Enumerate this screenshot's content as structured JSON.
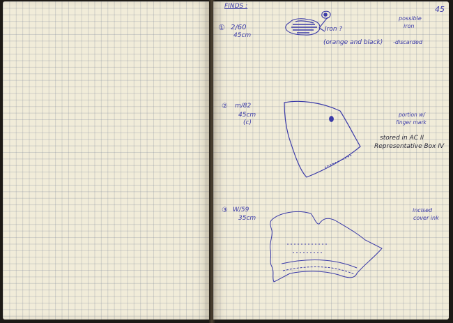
{
  "heading": "FINDS :",
  "page_number": "45",
  "finds": [
    {
      "marker": "①",
      "id": "2/60",
      "depth": "45cm",
      "label_lines": [
        "Iron ?",
        "(orange and black)"
      ],
      "notes": [
        "possible",
        "iron",
        "-discarded"
      ]
    },
    {
      "marker": "②",
      "id": "m/82",
      "depth": "45cm",
      "extra": "(c)",
      "notes": [
        "portion w/",
        "finger mark"
      ],
      "storage_lines": [
        "stored in AC II",
        "Representative Box IV"
      ]
    },
    {
      "marker": "③",
      "id": "W/59",
      "depth": "35cm",
      "notes": [
        "incised",
        "cover ink"
      ]
    }
  ],
  "ink_color": "#3a3aa8",
  "paper_color": "#f1ecd9"
}
